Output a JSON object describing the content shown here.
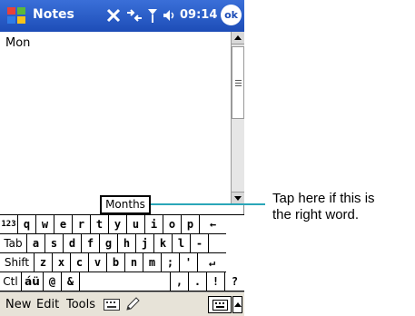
{
  "titlebar": {
    "app_title": "Notes",
    "time": "09:14",
    "ok_label": "ok"
  },
  "note": {
    "text": "Mon"
  },
  "suggestion": {
    "word": "Months"
  },
  "keyboard": {
    "row1": [
      "123",
      "q",
      "w",
      "e",
      "r",
      "t",
      "y",
      "u",
      "i",
      "o",
      "p",
      "←"
    ],
    "row2": [
      "Tab",
      "a",
      "s",
      "d",
      "f",
      "g",
      "h",
      "j",
      "k",
      "l",
      "-",
      ""
    ],
    "row3": [
      "Shift",
      "z",
      "x",
      "c",
      "v",
      "b",
      "n",
      "m",
      ";",
      "'",
      "↵"
    ],
    "row4": [
      "Ctl",
      "áü",
      "@",
      "&",
      "",
      ",",
      ".",
      "!",
      "?"
    ]
  },
  "menubar": {
    "new": "New",
    "edit": "Edit",
    "tools": "Tools"
  },
  "annotation": {
    "line1": "Tap here if this is",
    "line2": "the right word."
  },
  "icons": {
    "start": "windows-flag-icon",
    "connectivity": "connectivity-icon",
    "sync": "sync-icon",
    "signal": "signal-icon",
    "volume": "volume-icon",
    "keyboard": "keyboard-icon",
    "pen": "pen-icon"
  },
  "colors": {
    "titlebar": "#1d4db7",
    "callout": "#2aa6b8",
    "menubar": "#e7e3d8"
  }
}
